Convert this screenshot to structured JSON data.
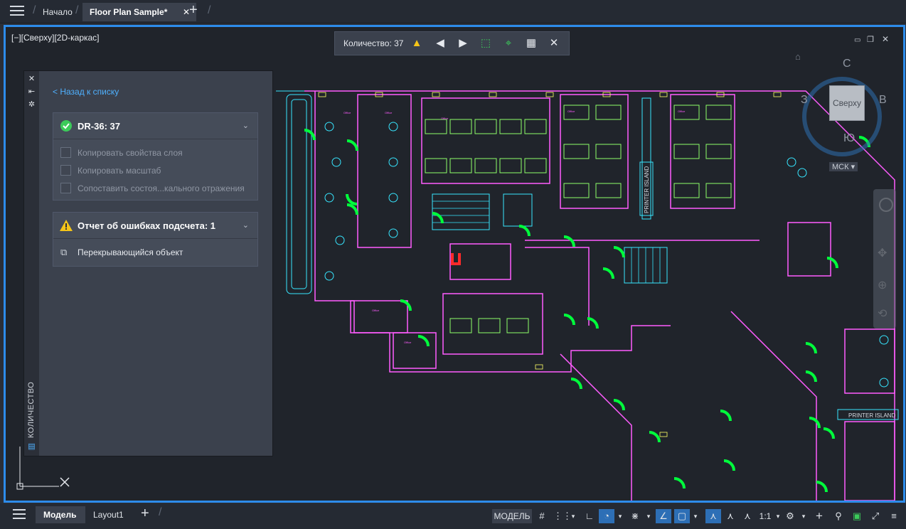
{
  "tabs": {
    "home": "Начало",
    "active": "Floor Plan Sample*",
    "close": "✕",
    "new": "+"
  },
  "viewport": {
    "label": "[−][Сверху][2D-каркас]"
  },
  "count_toolbar": {
    "label": "Количество:",
    "value": "37"
  },
  "panel": {
    "vertical_title": "КОЛИЧЕСТВО",
    "back_link": "< Назад к списку",
    "block_card": {
      "title": "DR-36: 37",
      "options": [
        "Копировать свойства слоя",
        "Копировать масштаб",
        "Сопоставить состоя...кального отражения"
      ]
    },
    "error_card": {
      "title": "Отчет об ошибках подсчета: 1",
      "item": "Перекрывающийся объект"
    }
  },
  "navcube": {
    "north": "С",
    "south": "Ю",
    "west": "З",
    "east": "В",
    "face": "Сверху",
    "ucs": "МСК"
  },
  "plan_labels": {
    "printer_island_1": "PRINTER ISLAND",
    "printer_island_2": "PRINTER ISLAND"
  },
  "bottom_tabs": {
    "model": "Модель",
    "layout": "Layout1"
  },
  "statusbar": {
    "model": "МОДЕЛЬ",
    "scale": "1:1"
  },
  "colors": {
    "accent": "#2d8ceb",
    "door_green": "#00ff3c",
    "wall_magenta": "#ff5cff",
    "furniture_cyan": "#37e6ff",
    "error_red": "#ff2a2a",
    "warning_yellow": "#f5c518",
    "ok_green": "#3ccb5a"
  }
}
